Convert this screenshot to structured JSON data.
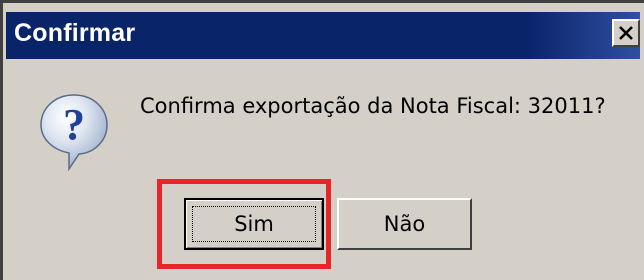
{
  "dialog": {
    "title": "Confirmar",
    "message": "Confirma exportação da Nota Fiscal: 32011?",
    "icon": "question-icon",
    "buttons": {
      "yes_label": "Sim",
      "no_label": "Não"
    },
    "close_icon": "close-icon",
    "highlight_color": "#e8262a",
    "titlebar_color": "#0a246a"
  }
}
